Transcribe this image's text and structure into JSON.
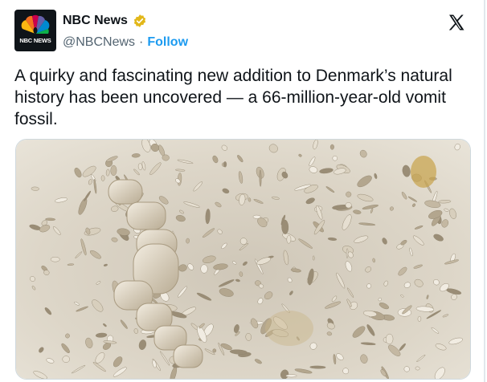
{
  "account": {
    "avatar_text": "NBC NEWS",
    "name": "NBC News",
    "handle": "@NBCNews",
    "separator": "·",
    "follow_label": "Follow",
    "verified": true
  },
  "tweet": {
    "text": "A quirky and fascinating new addition to Denmark’s natural history has been uncovered — a 66-million-year-old vomit fossil."
  },
  "icons": {
    "logo": "nbc-peacock-icon",
    "badge": "gold-verified-badge-icon",
    "platform": "x-logo-icon"
  },
  "colors": {
    "follow": "#1d9bf0",
    "badge": "#e2b719",
    "handle": "#536471"
  }
}
